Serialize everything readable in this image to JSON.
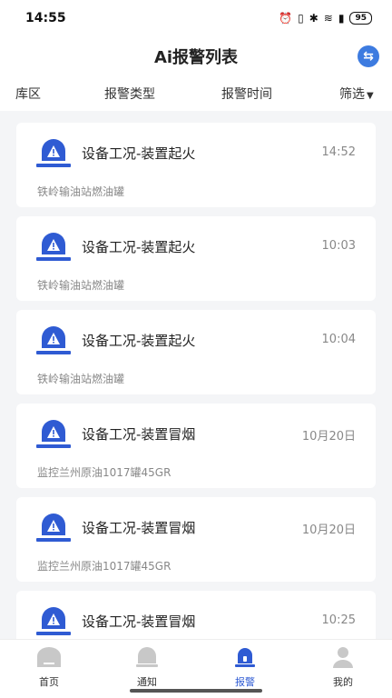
{
  "status_bar": {
    "time": "14:55",
    "battery": "95"
  },
  "header": {
    "title": "Ai报警列表"
  },
  "filters": [
    {
      "label": "库区"
    },
    {
      "label": "报警类型"
    },
    {
      "label": "报警时间"
    },
    {
      "label": "筛选"
    }
  ],
  "alarms": [
    {
      "title": "设备工况-装置起火",
      "time": "14:52",
      "location": "铁岭输油站燃油罐"
    },
    {
      "title": "设备工况-装置起火",
      "time": "10:03",
      "location": "铁岭输油站燃油罐"
    },
    {
      "title": "设备工况-装置起火",
      "time": "10:04",
      "location": "铁岭输油站燃油罐"
    },
    {
      "title": "设备工况-装置冒烟",
      "time": "10月20日",
      "location": "监控兰州原油1017罐45GR"
    },
    {
      "title": "设备工况-装置冒烟",
      "time": "10月20日",
      "location": "监控兰州原油1017罐45GR"
    },
    {
      "title": "设备工况-装置冒烟",
      "time": "10:25",
      "location": ""
    }
  ],
  "tabs": [
    {
      "label": "首页",
      "icon": "home-icon"
    },
    {
      "label": "通知",
      "icon": "bell-icon"
    },
    {
      "label": "报警",
      "icon": "alarm-icon",
      "active": true
    },
    {
      "label": "我的",
      "icon": "user-icon"
    }
  ],
  "colors": {
    "accent": "#2f5bd3",
    "inactive_icon": "#c8c8c8"
  }
}
